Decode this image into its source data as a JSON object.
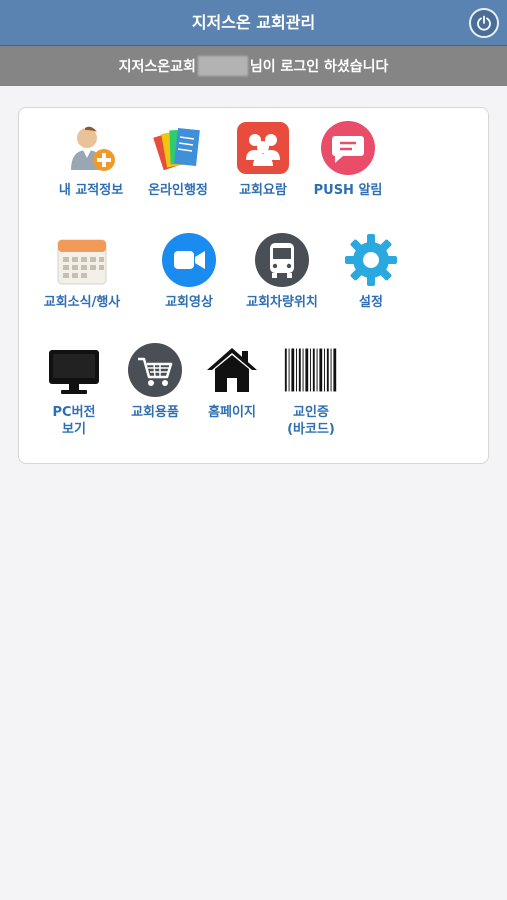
{
  "header": {
    "title": "지저스온 교회관리"
  },
  "login": {
    "prefix": "지저스온교회",
    "suffix": "님이 로그인 하셨습니다"
  },
  "menu": [
    {
      "label": "내 교적정보",
      "icon": "user-add-icon"
    },
    {
      "label": "온라인행정",
      "icon": "documents-icon"
    },
    {
      "label": "교회요람",
      "icon": "people-group-icon"
    },
    {
      "label": "PUSH 알림",
      "icon": "chat-bubble-icon"
    },
    {
      "label": "교회소식/행사",
      "icon": "calendar-icon"
    },
    {
      "label": "교회영상",
      "icon": "video-camera-icon"
    },
    {
      "label": "교회차량위치",
      "icon": "bus-icon"
    },
    {
      "label": "설정",
      "icon": "gear-icon"
    },
    {
      "label": "PC버전\n보기",
      "icon": "monitor-icon"
    },
    {
      "label": "교회용품",
      "icon": "shopping-cart-icon"
    },
    {
      "label": "홈페이지",
      "icon": "home-icon"
    },
    {
      "label": "교인증\n(바코드)",
      "icon": "barcode-icon"
    }
  ],
  "colors": {
    "header": "#5b83b2",
    "login_bar": "#858585",
    "label": "#2f6fb3"
  }
}
